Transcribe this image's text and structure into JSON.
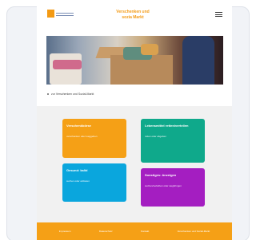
{
  "site": {
    "title_line1": "Verschenken und",
    "title_line2": "sozia Markt"
  },
  "breadcrumb": {
    "text": "zur Verschenken und Sozial-Markt"
  },
  "tiles": [
    {
      "title": "Verschenkbörse",
      "subtitle": "verschenken oder weggeben"
    },
    {
      "title": "Lebensmittel retten/verteilen",
      "subtitle": "retten oder abgeben"
    },
    {
      "title": "Gesund: kalid",
      "subtitle": "suchen oder anbieten"
    },
    {
      "title": "Sonstiges: Anzeigen",
      "subtitle": "suchen/verleihen oder wegbringen"
    }
  ],
  "footer": {
    "links": [
      "Impressum",
      "Datenschutz",
      "Kontakt",
      "Verschenken und Sozial-Markt"
    ]
  },
  "colors": {
    "accent": "#f5a016",
    "green": "#0fa98b",
    "blue": "#0aa6dd",
    "purple": "#a41ec1"
  }
}
